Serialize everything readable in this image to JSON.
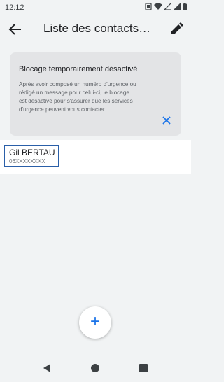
{
  "status_bar": {
    "time": "12:12",
    "icons": [
      "vibrate-icon",
      "wifi-icon",
      "signal-icon",
      "signal-icon",
      "battery-icon"
    ]
  },
  "app_bar": {
    "title": "Liste des contacts…",
    "back_icon": "arrow-left-icon",
    "edit_icon": "pencil-icon"
  },
  "notice": {
    "title": "Blocage temporairement désactivé",
    "body_lines": [
      "Après avoir composé un numéro d'urgence ou",
      "rédigé un message pour celui-ci, le blocage",
      "est désactivé pour s'assurer que les services",
      "d'urgence peuvent vous contacter."
    ],
    "close_icon": "close-icon"
  },
  "contacts": [
    {
      "name": "Gil BERTAU",
      "number": "06XXXXXXXX"
    }
  ],
  "fab": {
    "label": "+"
  },
  "nav_bar": {
    "icons": [
      "back-triangle-icon",
      "home-circle-icon",
      "recents-square-icon"
    ]
  },
  "colors": {
    "accent": "#1a73e8",
    "focus_border": "#2a5fa8",
    "background": "#f1f3f4",
    "card": "#e3e4e6"
  }
}
